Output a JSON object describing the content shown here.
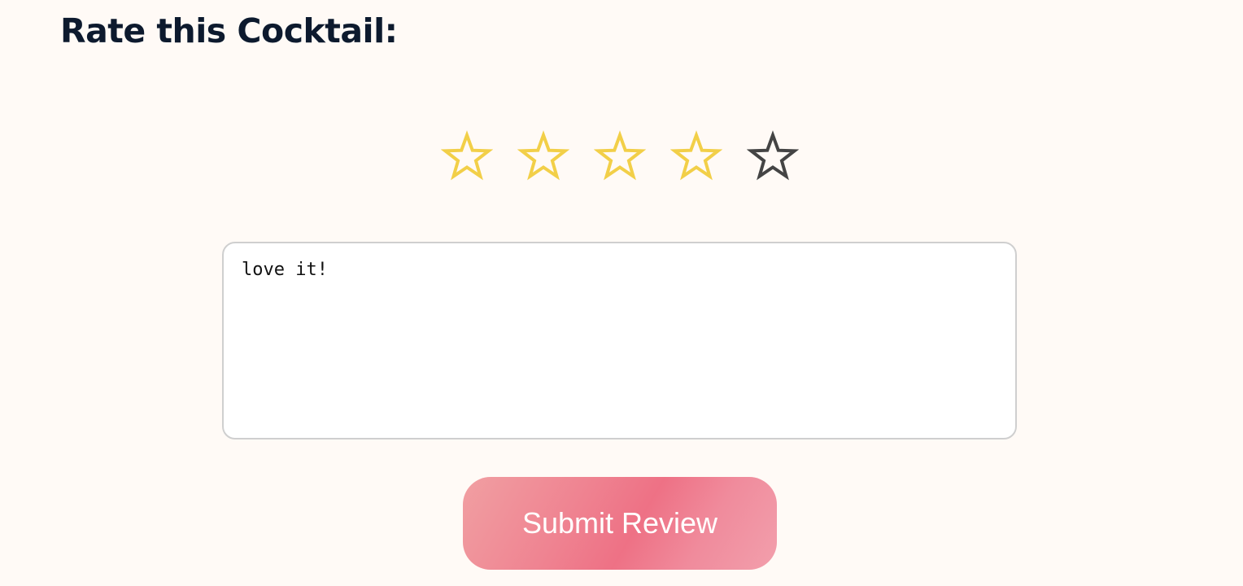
{
  "heading": {
    "title": "Rate this Cocktail:"
  },
  "rating": {
    "value": 4,
    "max": 5,
    "filled_color": "#f2cf48",
    "empty_color": "#444444",
    "stars": [
      {
        "icon": "star-icon",
        "filled": true
      },
      {
        "icon": "star-icon",
        "filled": true
      },
      {
        "icon": "star-icon",
        "filled": true
      },
      {
        "icon": "star-icon",
        "filled": true
      },
      {
        "icon": "star-icon",
        "filled": false
      }
    ]
  },
  "review": {
    "value": "love it!"
  },
  "actions": {
    "submit_label": "Submit Review"
  }
}
